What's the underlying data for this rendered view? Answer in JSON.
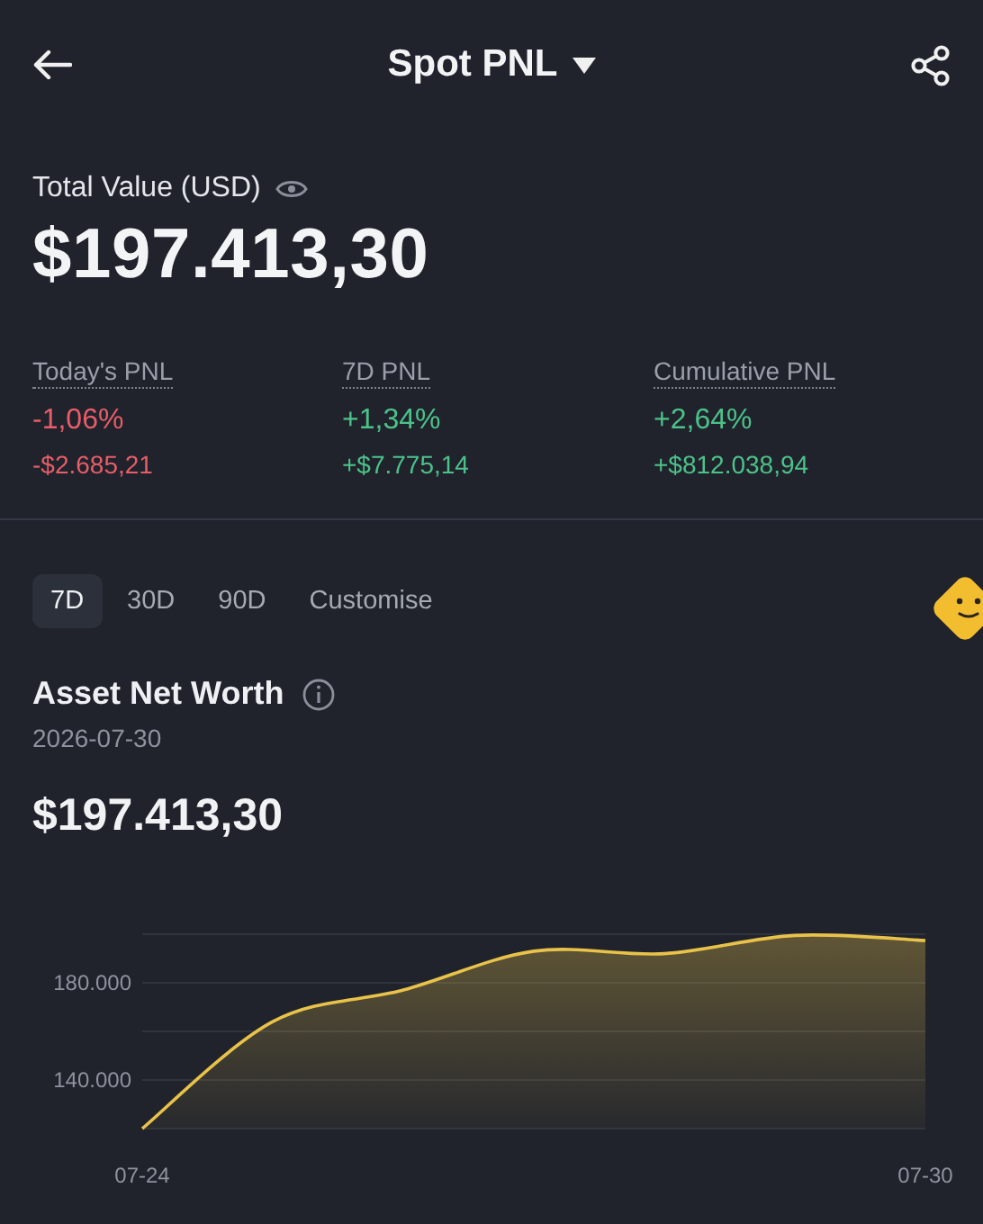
{
  "header": {
    "title": "Spot PNL"
  },
  "total_value": {
    "label": "Total Value (USD)",
    "amount": "$197.413,30"
  },
  "pnl": [
    {
      "label": "Today's PNL",
      "percent": "-1,06%",
      "amount": "-$2.685,21",
      "color": "#e85d69"
    },
    {
      "label": "7D PNL",
      "percent": "+1,34%",
      "amount": "+$7.775,14",
      "color": "#4cc28a"
    },
    {
      "label": "Cumulative PNL",
      "percent": "+2,64%",
      "amount": "+$812.038,94",
      "color": "#4cc28a"
    }
  ],
  "tabs": [
    {
      "label": "7D",
      "selected": true
    },
    {
      "label": "30D",
      "selected": false
    },
    {
      "label": "90D",
      "selected": false
    },
    {
      "label": "Customise",
      "selected": false
    }
  ],
  "net_worth": {
    "title": "Asset Net Worth",
    "date": "2026-07-30",
    "amount": "$197.413,30",
    "chart_data": {
      "type": "area",
      "categories": [
        "07-24",
        null,
        null,
        null,
        null,
        null,
        "07-30"
      ],
      "series": [
        {
          "color": "#e9c24a",
          "values": [
            120000,
            164000,
            177000,
            193000,
            192000,
            199500,
            197400
          ]
        }
      ],
      "ylim": [
        120000,
        200000
      ],
      "yticks": [
        {
          "value": 140000,
          "label": "140.000"
        },
        {
          "value": 180000,
          "label": "180.000"
        }
      ]
    }
  }
}
